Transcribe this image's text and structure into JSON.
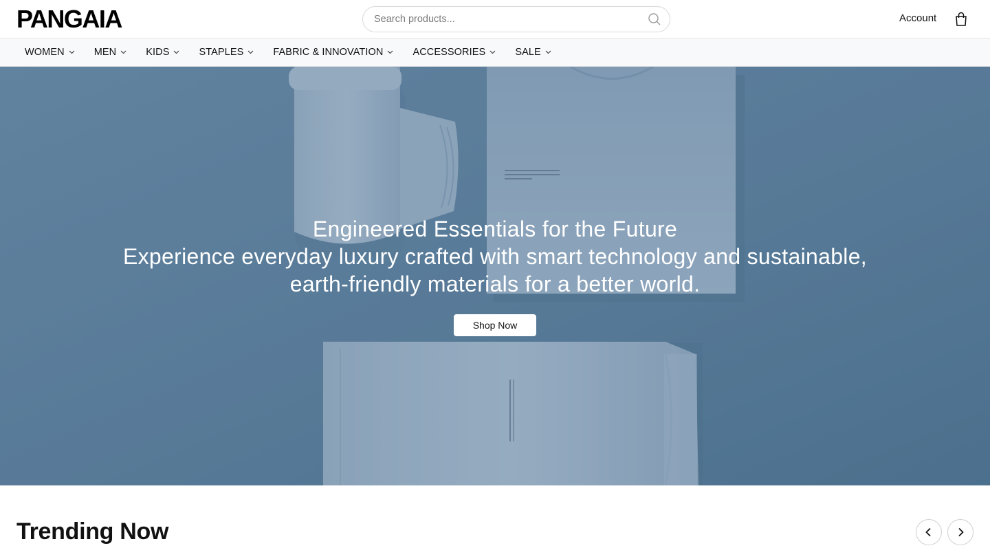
{
  "brand": {
    "logo": "PANGAIA"
  },
  "search": {
    "placeholder": "Search products..."
  },
  "header": {
    "account_label": "Account"
  },
  "nav": {
    "items": [
      {
        "label": "WOMEN"
      },
      {
        "label": "MEN"
      },
      {
        "label": "KIDS"
      },
      {
        "label": "STAPLES"
      },
      {
        "label": "FABRIC & INNOVATION"
      },
      {
        "label": "ACCESSORIES"
      },
      {
        "label": "SALE"
      }
    ]
  },
  "hero": {
    "title": "Engineered Essentials for the Future",
    "subtitle": "Experience everyday luxury crafted with smart technology and sustainable, earth-friendly materials for a better world.",
    "cta_label": "Shop Now",
    "background_color": "#5d809c"
  },
  "trending": {
    "title": "Trending Now"
  },
  "icons": {
    "search": "search-icon",
    "bag": "shopping-bag-icon",
    "nav_chevron": "chevron-down-icon",
    "prev": "chevron-left-icon",
    "next": "chevron-right-icon"
  }
}
